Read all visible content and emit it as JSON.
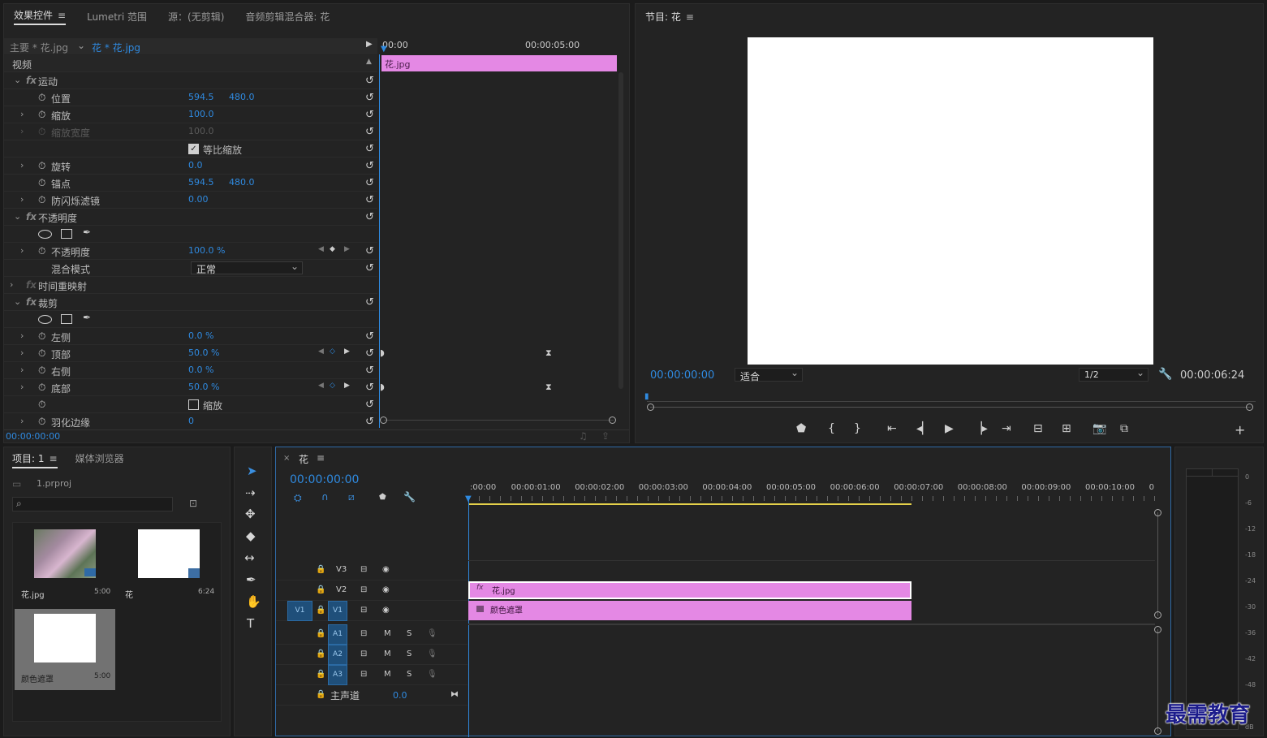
{
  "effect_controls": {
    "tabs": [
      "效果控件",
      "Lumetri 范围",
      "源：(无剪辑)",
      "音频剪辑混合器: 花"
    ],
    "master_label": "主要 * 花.jpg",
    "clip_label": "花 * 花.jpg",
    "ruler_start": "00:00",
    "ruler_mid": "00:00:05:00",
    "clip_bar_label": "花.jpg",
    "section_video": "视频",
    "rows": {
      "motion": "运动",
      "position": {
        "label": "位置",
        "x": "594.5",
        "y": "480.0"
      },
      "scale": {
        "label": "缩放",
        "value": "100.0"
      },
      "scale_width": {
        "label": "缩放宽度",
        "value": "100.0"
      },
      "uniform_scale": "等比缩放",
      "rotation": {
        "label": "旋转",
        "value": "0.0"
      },
      "anchor": {
        "label": "锚点",
        "x": "594.5",
        "y": "480.0"
      },
      "flicker": {
        "label": "防闪烁滤镜",
        "value": "0.00"
      },
      "opacity_group": "不透明度",
      "opacity": {
        "label": "不透明度",
        "value": "100.0 %"
      },
      "blend": {
        "label": "混合模式",
        "value": "正常"
      },
      "time_remap": "时间重映射",
      "crop": "裁剪",
      "left": {
        "label": "左侧",
        "value": "0.0 %"
      },
      "top": {
        "label": "顶部",
        "value": "50.0 %"
      },
      "right": {
        "label": "右侧",
        "value": "0.0 %"
      },
      "bottom": {
        "label": "底部",
        "value": "50.0 %"
      },
      "zoom": "缩放",
      "feather": {
        "label": "羽化边缘",
        "value": "0"
      }
    },
    "footer_time": "00:00:00:00"
  },
  "program": {
    "title": "节目: 花",
    "timecode": "00:00:00:00",
    "fit": "适合",
    "resolution": "1/2",
    "duration": "00:00:06:24"
  },
  "project": {
    "tabs": [
      "项目: 1",
      "媒体浏览器"
    ],
    "file": "1.prproj",
    "items": [
      {
        "name": "花.jpg",
        "dur": "5:00"
      },
      {
        "name": "花",
        "dur": "6:24"
      },
      {
        "name": "颜色遮罩",
        "dur": "5:00"
      }
    ]
  },
  "timeline": {
    "title": "花",
    "timecode": "00:00:00:00",
    "ruler": [
      ":00:00",
      "00:00:01:00",
      "00:00:02:00",
      "00:00:03:00",
      "00:00:04:00",
      "00:00:05:00",
      "00:00:06:00",
      "00:00:07:00",
      "00:00:08:00",
      "00:00:09:00",
      "00:00:10:00",
      "0"
    ],
    "tracks": {
      "v3": "V3",
      "v2": "V2",
      "v1": "V1",
      "src": "V1",
      "a1": "A1",
      "a2": "A2",
      "a3": "A3",
      "m": "M",
      "s": "S"
    },
    "master": "主声道",
    "master_val": "0.0",
    "clip_top": "花.jpg",
    "clip_bottom": "颜色遮罩"
  },
  "meter": {
    "labels": [
      "0",
      "-6",
      "-12",
      "-18",
      "-24",
      "-30",
      "-36",
      "-42",
      "-48",
      "dB"
    ]
  },
  "watermark": "最需教育",
  "colors": {
    "accent": "#2f8ae0",
    "clip": "#e488e4"
  }
}
